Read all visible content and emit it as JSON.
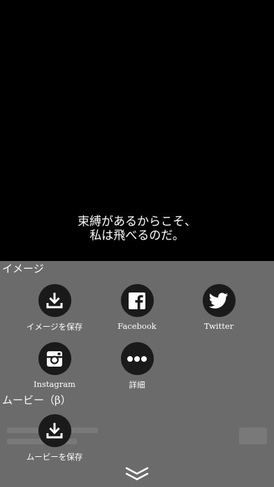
{
  "quote": {
    "line1": "束縛があるからこそ、",
    "line2": "私は飛べるのだ。"
  },
  "sections": {
    "image_title": "イメージ",
    "movie_title": "ムービー（β）"
  },
  "actions": {
    "save_image": "イメージを保存",
    "facebook": "Facebook",
    "twitter": "Twitter",
    "instagram": "Instagram",
    "more": "詳細",
    "save_movie": "ムービーを保存"
  },
  "icons": {
    "save_image": "download-icon",
    "facebook": "facebook-icon",
    "twitter": "twitter-icon",
    "instagram": "instagram-icon",
    "more": "more-dots-icon",
    "save_movie": "download-icon",
    "close": "chevron-double-down-icon"
  },
  "colors": {
    "background": "#000000",
    "sheet": "#6b6b6b",
    "icon_circle": "#1a1a1a",
    "text": "#ffffff"
  }
}
